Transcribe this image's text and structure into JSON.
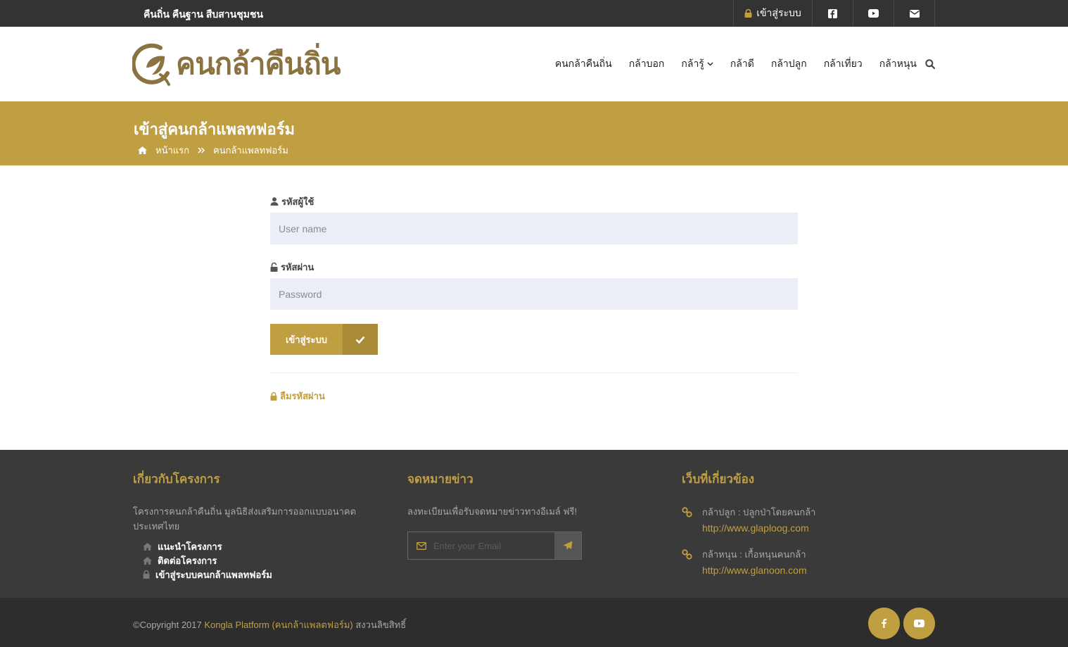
{
  "topbar": {
    "tagline": "คืนถิ่น คืนฐาน สืบสานชุมชน",
    "login_label": "เข้าสู่ระบบ",
    "social_icons": [
      "facebook-icon",
      "youtube-icon",
      "envelope-icon"
    ]
  },
  "header": {
    "logo_text": "คนกล้าคืนถิ่น",
    "nav": [
      {
        "label": "คนกล้าคืนถิ่น"
      },
      {
        "label": "กล้าบอก"
      },
      {
        "label": "กล้ารู้"
      },
      {
        "label": "กล้าดี"
      },
      {
        "label": "กล้าปลูก"
      },
      {
        "label": "กล้าเที่ยว"
      },
      {
        "label": "กล้าหนุน"
      }
    ]
  },
  "banner": {
    "title": "เข้าสู่คนกล้าแพลทฟอร์ม",
    "breadcrumb": [
      "หน้าแรก",
      "คนกล้าแพลทฟอร์ม"
    ]
  },
  "form": {
    "username_label": "รหัสผู้ใช้",
    "username_placeholder": "User name",
    "username_value": "",
    "password_label": "รหัสผ่าน",
    "password_placeholder": "Password",
    "password_value": "",
    "submit_label": "เข้าสู่ระบบ",
    "forgot_label": "ลืมรหัสผ่าน"
  },
  "footer": {
    "about": {
      "title": "เกี่ยวกับโครงการ",
      "description": "โครงการคนกล้าคืนถิ่น มูลนิธิส่งเสริมการออกแบบอนาคตประเทศไทย",
      "links": [
        "แนะนำโครงการ",
        "ติดต่อโครงการ",
        "เข้าสู่ระบบคนกล้าแพลทฟอร์ม"
      ]
    },
    "newsletter": {
      "title": "จดหมายข่าว",
      "description": "ลงทะเบียนเพื่อรับจดหมายข่าวทางอีเมล์ ฟรี!",
      "email_placeholder": "Enter your Email"
    },
    "related": {
      "title": "เว็บที่เกี่ยวข้อง",
      "items": [
        {
          "name": "กล้าปลูก : ปลูกป่าโดยคนกล้า",
          "url": "http://www.glaploog.com"
        },
        {
          "name": "กล้าหนุน : เกื้อหนุนคนกล้า",
          "url": "http://www.glanoon.com"
        }
      ]
    }
  },
  "bottom": {
    "copyright_prefix": "©Copyright 2017 ",
    "brand": "Kongla Platform (คนกล้าแพลตฟอร์ม)",
    "copyright_suffix": " สงวนลิขสิทธิ์"
  },
  "colors": {
    "accent": "#c09f42",
    "topbar": "#333333",
    "footer": "#3a3a3a",
    "bottombar": "#2d2d2d",
    "input_bg": "#ebeef7"
  }
}
